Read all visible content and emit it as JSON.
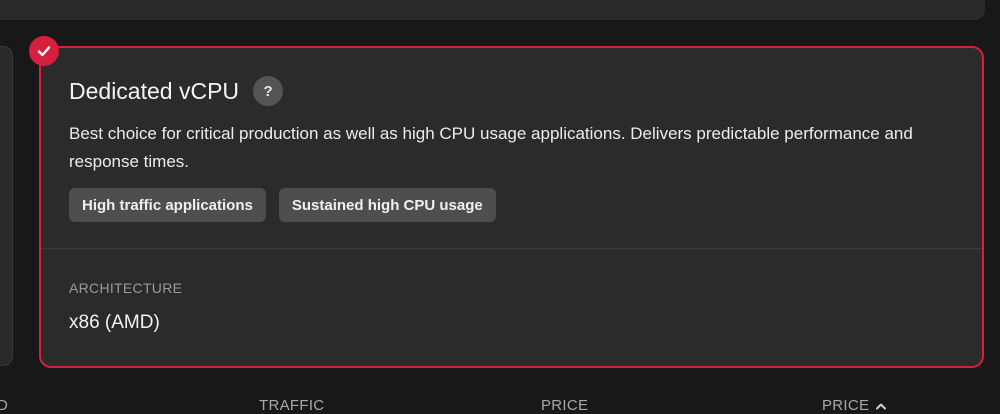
{
  "card": {
    "title": "Dedicated vCPU",
    "help_label": "?",
    "description": "Best choice for critical production as well as high CPU usage applications. Delivers predictable performance and response times.",
    "tags": [
      "High traffic applications",
      "Sustained high CPU usage"
    ],
    "architecture_label": "ARCHITECTURE",
    "architecture_value": "x86 (AMD)",
    "selected": true
  },
  "table_headers": {
    "partial_first": "D",
    "traffic": "TRAFFIC",
    "price": "PRICE",
    "price_sorted": "PRICE",
    "sorted_icon": "chevron-up-icon"
  },
  "colors": {
    "accent": "#d61f3f",
    "background": "#181818",
    "card": "#2b2b2b",
    "tag": "#4e4e4e"
  }
}
